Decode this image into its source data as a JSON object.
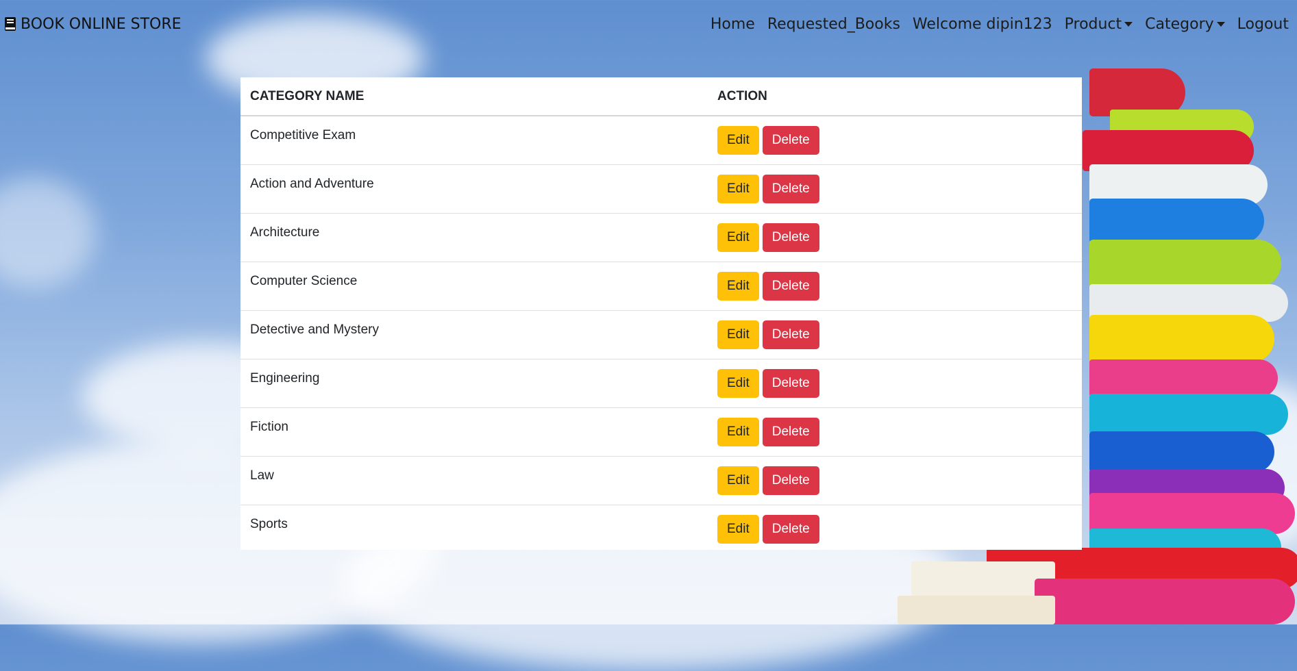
{
  "navbar": {
    "brand": "BOOK ONLINE STORE",
    "brand_icon": "book-icon",
    "links": {
      "home": "Home",
      "requested": "Requested_Books",
      "welcome": "Welcome dipin123",
      "product": "Product",
      "category": "Category",
      "logout": "Logout"
    }
  },
  "table": {
    "headers": {
      "name": "CATEGORY NAME",
      "action": "ACTION"
    },
    "edit_label": "Edit",
    "delete_label": "Delete",
    "rows": [
      "Competitive Exam",
      "Action and Adventure",
      "Architecture",
      "Computer Science",
      "Detective and Mystery",
      "Engineering",
      "Fiction",
      "Law",
      "Sports"
    ]
  },
  "colors": {
    "edit": "#ffc107",
    "delete": "#dc3545"
  }
}
